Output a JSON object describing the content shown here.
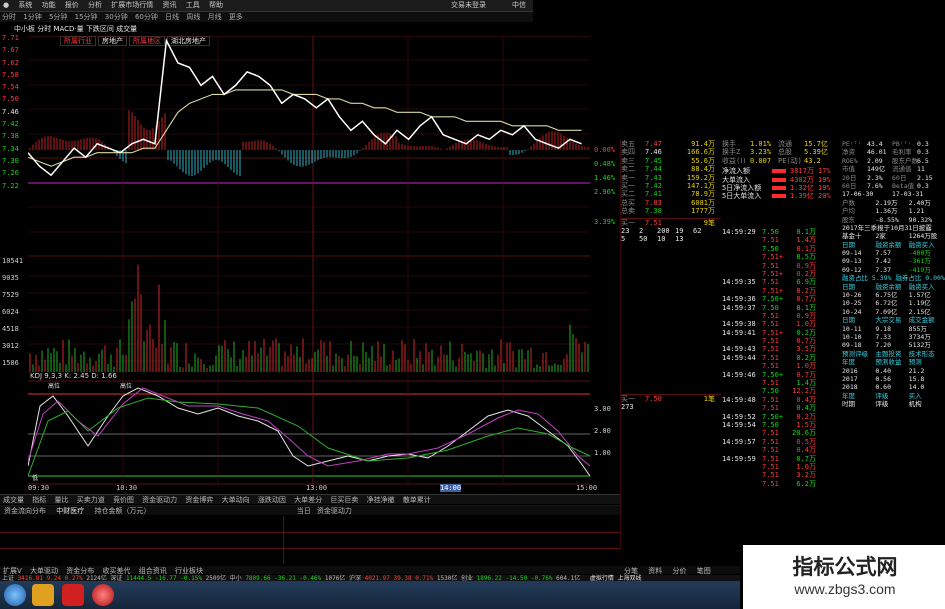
{
  "menu": [
    "系统",
    "功能",
    "报价",
    "分析",
    "扩展市场行情",
    "资讯",
    "工具",
    "帮助"
  ],
  "top_right": [
    "交易未登录",
    "中信"
  ],
  "periods": [
    "分时",
    "1分钟",
    "5分钟",
    "15分钟",
    "30分钟",
    "60分钟",
    "日线",
    "周线",
    "月线",
    "更多"
  ],
  "chart_title": "中小板 分时 MACD·量 下跌区间 成交量",
  "chart_badges": [
    "所属行业",
    "房地产",
    "所属地区",
    "湖北房地产"
  ],
  "price_axis": [
    "7.71",
    "7.67",
    "7.62",
    "7.58",
    "7.54",
    "7.50",
    "7.46",
    "7.42",
    "7.38",
    "7.34",
    "7.30",
    "7.26",
    "7.22"
  ],
  "pct_axis": [
    "0.00%",
    "0.48%",
    "1.46%",
    "2.96%",
    "3.39%"
  ],
  "vol_axis": [
    "10541",
    "9035",
    "7529",
    "6024",
    "4518",
    "3012",
    "1506"
  ],
  "kdj_header": "KDJ 9,3,3 K: 2.45 D: 1.66",
  "kdj_axis": [
    "3.00",
    "2.00",
    "1.00"
  ],
  "time_axis": [
    "09:30",
    "10:30",
    "13:00",
    "14:00",
    "15:00"
  ],
  "bottom_tabs": [
    "成交量",
    "指标",
    "量比",
    "买卖力道",
    "竞价图",
    "资金驱动力",
    "资金博弈",
    "大单动向",
    "涨跌动因",
    "大单差分",
    "巨买巨卖",
    "净挂净撤",
    "散单累计"
  ],
  "fund_tabs": [
    "资金流向分布",
    "中财医疗",
    "持仓金额（万元）",
    "当日",
    "资金驱动力"
  ],
  "status_tabs": [
    "扩展V",
    "大单驱动",
    "资金分布",
    "收买差代",
    "组合资讯",
    "行业板块"
  ],
  "order_book": {
    "sells": [
      {
        "label": "卖五",
        "price": "7.47",
        "vol": "91.4万"
      },
      {
        "label": "卖四",
        "price": "7.46",
        "vol": "166.6万"
      },
      {
        "label": "卖三",
        "price": "7.45",
        "vol": "55.6万"
      },
      {
        "label": "卖二",
        "price": "7.44",
        "vol": "88.4万"
      },
      {
        "label": "卖一",
        "price": "7.43",
        "vol": "159.2万"
      },
      {
        "label": "买一",
        "price": "7.42",
        "vol": "147.1万"
      },
      {
        "label": "买二",
        "price": "7.41",
        "vol": "78.9万"
      }
    ],
    "total_buy": {
      "label": "总买",
      "price": "7.83",
      "vol": "6081万"
    },
    "total_sell": {
      "label": "总卖",
      "price": "7.38",
      "vol": "1777万"
    },
    "buy_row": {
      "label": "买一",
      "price": "7.51",
      "vol": "9笔"
    },
    "queue": [
      [
        "23",
        "2",
        "200",
        "19",
        "62"
      ],
      [
        "5",
        "50",
        "10",
        "13",
        ""
      ]
    ],
    "buy_row2": {
      "label": "买一",
      "price": "7.50",
      "vol": "1笔",
      "queue": "273"
    }
  },
  "stats": {
    "rows": [
      [
        "换手",
        "1.01%",
        "流通",
        "15.7亿"
      ],
      [
        "换手Z",
        "3.23%",
        "总股",
        "5.39亿"
      ],
      [
        "收益(Ⅰ)",
        "0.007",
        "PE(动)",
        "43.2"
      ]
    ],
    "flows": [
      {
        "label": "净流入额",
        "value": "3817万",
        "pct": "17%"
      },
      {
        "label": "大单流入",
        "value": "4302万",
        "pct": "19%"
      },
      {
        "label": "5日净流入额",
        "value": "1.32亿",
        "pct": "19%"
      },
      {
        "label": "5日大单流入",
        "value": "1.39亿",
        "pct": "20%"
      }
    ]
  },
  "right_info": {
    "top": [
      [
        "PE⁽ᵀ⁾",
        "43.4",
        "PB⁽ᵀ⁾",
        "0.3"
      ],
      [
        "净资",
        "46.01",
        "毛利率",
        "0.3"
      ],
      [
        "ROE%",
        "2.09",
        "股东户数",
        "6.5"
      ],
      [
        "市值",
        "149亿",
        "流通值",
        "11"
      ],
      [
        "20日",
        "2.3%",
        "60日",
        "2.15"
      ],
      [
        "60日",
        "7.6%",
        "Beta值",
        "0.3"
      ]
    ],
    "dates": [
      "17-06-30",
      "17-03-31"
    ],
    "holders": [
      [
        "户数",
        "2.19万",
        "2.40万"
      ],
      [
        "户均",
        "1.36万",
        "1.21"
      ],
      [
        "股东",
        "-8.55%",
        "90.32%"
      ]
    ],
    "note": "2017年三季报于10月31日披露",
    "base": [
      "基金十",
      "2家",
      "1264万股"
    ],
    "fin_header": [
      "日期",
      "融资余额",
      "融资买入"
    ],
    "fin_rows": [
      [
        "09-14",
        "7.57",
        "-400万"
      ],
      [
        "09-13",
        "7.42",
        "-361万"
      ],
      [
        "09-12",
        "7.37",
        "-419万"
      ]
    ],
    "margin_ratio": "融资占比 5.39%  融券占比 0.00%",
    "margin_header": [
      "日期",
      "融资余额",
      "融资买入"
    ],
    "margin_rows": [
      [
        "10-26",
        "6.75亿",
        "1.57亿"
      ],
      [
        "10-25",
        "6.72亿",
        "1.19亿"
      ],
      [
        "10-24",
        "7.09亿",
        "2.15亿"
      ]
    ],
    "block_header": [
      "日期",
      "大宗交易",
      "成交金额"
    ],
    "block_rows": [
      [
        "10-11",
        "9.18",
        "855万"
      ],
      [
        "10-10",
        "7.33",
        "3734万"
      ],
      [
        "09-18",
        "7.20",
        "5132万"
      ]
    ],
    "forecast_tabs": [
      "预测评级",
      "主题投资",
      "技术形态"
    ],
    "forecast_header": [
      "年度",
      "预测收益",
      "预测"
    ],
    "forecast_rows": [
      [
        "2016",
        "0.40",
        "21.2"
      ],
      [
        "2017",
        "0.56",
        "15.8"
      ],
      [
        "2018",
        "0.60",
        "14.0"
      ]
    ],
    "rating_header": [
      "年度",
      "评级",
      "买入"
    ],
    "rating_rows": [
      [
        "时期",
        "评级",
        "机构"
      ]
    ]
  },
  "ticks": [
    [
      "14:59:29",
      "7.50",
      "8.1万"
    ],
    [
      "",
      "7.51",
      "1.4万"
    ],
    [
      "",
      "7.50",
      "8.1万"
    ],
    [
      "",
      "7.51+",
      "8.5万"
    ],
    [
      "",
      "7.51",
      "0.9万"
    ],
    [
      "",
      "7.51+",
      "0.2万"
    ],
    [
      "14:59:35",
      "7.51",
      "6.9万"
    ],
    [
      "",
      "7.51+",
      "8.2万"
    ],
    [
      "14:59:36",
      "7.50+",
      "0.7万"
    ],
    [
      "14:59:37",
      "7.50",
      "8.1万"
    ],
    [
      "",
      "7.51",
      "0.9万"
    ],
    [
      "14:59:38",
      "7.51",
      "1.0万"
    ],
    [
      "14:59:41",
      "7.51+",
      "0.2万"
    ],
    [
      "",
      "7.51",
      "0.7万"
    ],
    [
      "14:59:43",
      "7.51",
      "3.5万"
    ],
    [
      "14:59:44",
      "7.51",
      "0.2万"
    ],
    [
      "",
      "7.51",
      "1.0万"
    ],
    [
      "14:59:46",
      "7.50+",
      "0.7万"
    ],
    [
      "",
      "7.51",
      "1.4万"
    ],
    [
      "",
      "7.50",
      "12.2万"
    ],
    [
      "14:59:48",
      "7.51",
      "0.4万"
    ],
    [
      "",
      "7.51",
      "0.4万"
    ],
    [
      "14:59:52",
      "7.50+",
      "0.2万"
    ],
    [
      "14:59:54",
      "7.50",
      "1.5万"
    ],
    [
      "",
      "7.51",
      "20.6万"
    ],
    [
      "14:59:57",
      "7.51",
      "0.5万"
    ],
    [
      "",
      "7.51",
      "0.4万"
    ],
    [
      "14:59:59",
      "7.51",
      "0.7万"
    ],
    [
      "",
      "7.51",
      "1.0万"
    ],
    [
      "",
      "7.51",
      "3.2万"
    ],
    [
      "",
      "7.51",
      "6.2万"
    ]
  ],
  "mid_tabs": [
    "分笔",
    "资料",
    "分价",
    "笔图"
  ],
  "status_bar": [
    {
      "label": "上证",
      "value": "3416.81",
      "chg": "9.24",
      "pct": "0.27%",
      "amt": "2124亿"
    },
    {
      "label": "深证",
      "value": "11444.5",
      "chg": "-16.77",
      "pct": "-0.15%",
      "amt": "2509亿"
    },
    {
      "label": "中小",
      "value": "7809.66",
      "chg": "-36.21",
      "pct": "-0.46%",
      "amt": "1076亿"
    },
    {
      "label": "沪深",
      "value": "4021.97",
      "chg": "39.38",
      "pct": "0.71%",
      "amt": "1530亿"
    },
    {
      "label": "创业",
      "value": "1896.22",
      "chg": "-14.50",
      "pct": "-0.76%",
      "amt": "604.1亿"
    }
  ],
  "status_right": "虚拟行情 上海双线",
  "watermark_cn": "指标公式网",
  "watermark_url": "www.zbgs3.com",
  "chart_data": {
    "type": "line",
    "title": "",
    "x": [
      0,
      1,
      2,
      3,
      4,
      5,
      6,
      7,
      8,
      9,
      10,
      11,
      12,
      13,
      14,
      15,
      16,
      17,
      18,
      19,
      20,
      21,
      22,
      23,
      24,
      25,
      26,
      27,
      28,
      29,
      30,
      31,
      32,
      33,
      34,
      35,
      36,
      37,
      38,
      39,
      40,
      41,
      42,
      43,
      44,
      45,
      46,
      47,
      48
    ],
    "series": [
      {
        "name": "price",
        "values": [
          7.45,
          7.42,
          7.4,
          7.43,
          7.46,
          7.44,
          7.47,
          7.46,
          7.45,
          7.47,
          7.48,
          7.47,
          7.7,
          7.65,
          7.64,
          7.6,
          7.62,
          7.58,
          7.6,
          7.63,
          7.62,
          7.6,
          7.56,
          7.58,
          7.57,
          7.55,
          7.57,
          7.53,
          7.5,
          7.52,
          7.49,
          7.47,
          7.5,
          7.48,
          7.51,
          7.53,
          7.49,
          7.48,
          7.47,
          7.49,
          7.48,
          7.5,
          7.49,
          7.51,
          7.48,
          7.47,
          7.46,
          7.48,
          7.47
        ]
      },
      {
        "name": "avg",
        "values": [
          7.44,
          7.43,
          7.42,
          7.43,
          7.44,
          7.44,
          7.45,
          7.45,
          7.45,
          7.45,
          7.46,
          7.46,
          7.5,
          7.54,
          7.56,
          7.57,
          7.58,
          7.58,
          7.59,
          7.59,
          7.59,
          7.59,
          7.59,
          7.58,
          7.58,
          7.58,
          7.57,
          7.57,
          7.56,
          7.56,
          7.55,
          7.55,
          7.54,
          7.54,
          7.54,
          7.53,
          7.53,
          7.53,
          7.52,
          7.52,
          7.52,
          7.52,
          7.51,
          7.51,
          7.51,
          7.51,
          7.5,
          7.5,
          7.5
        ]
      }
    ],
    "ylim": [
      7.22,
      7.71
    ]
  }
}
